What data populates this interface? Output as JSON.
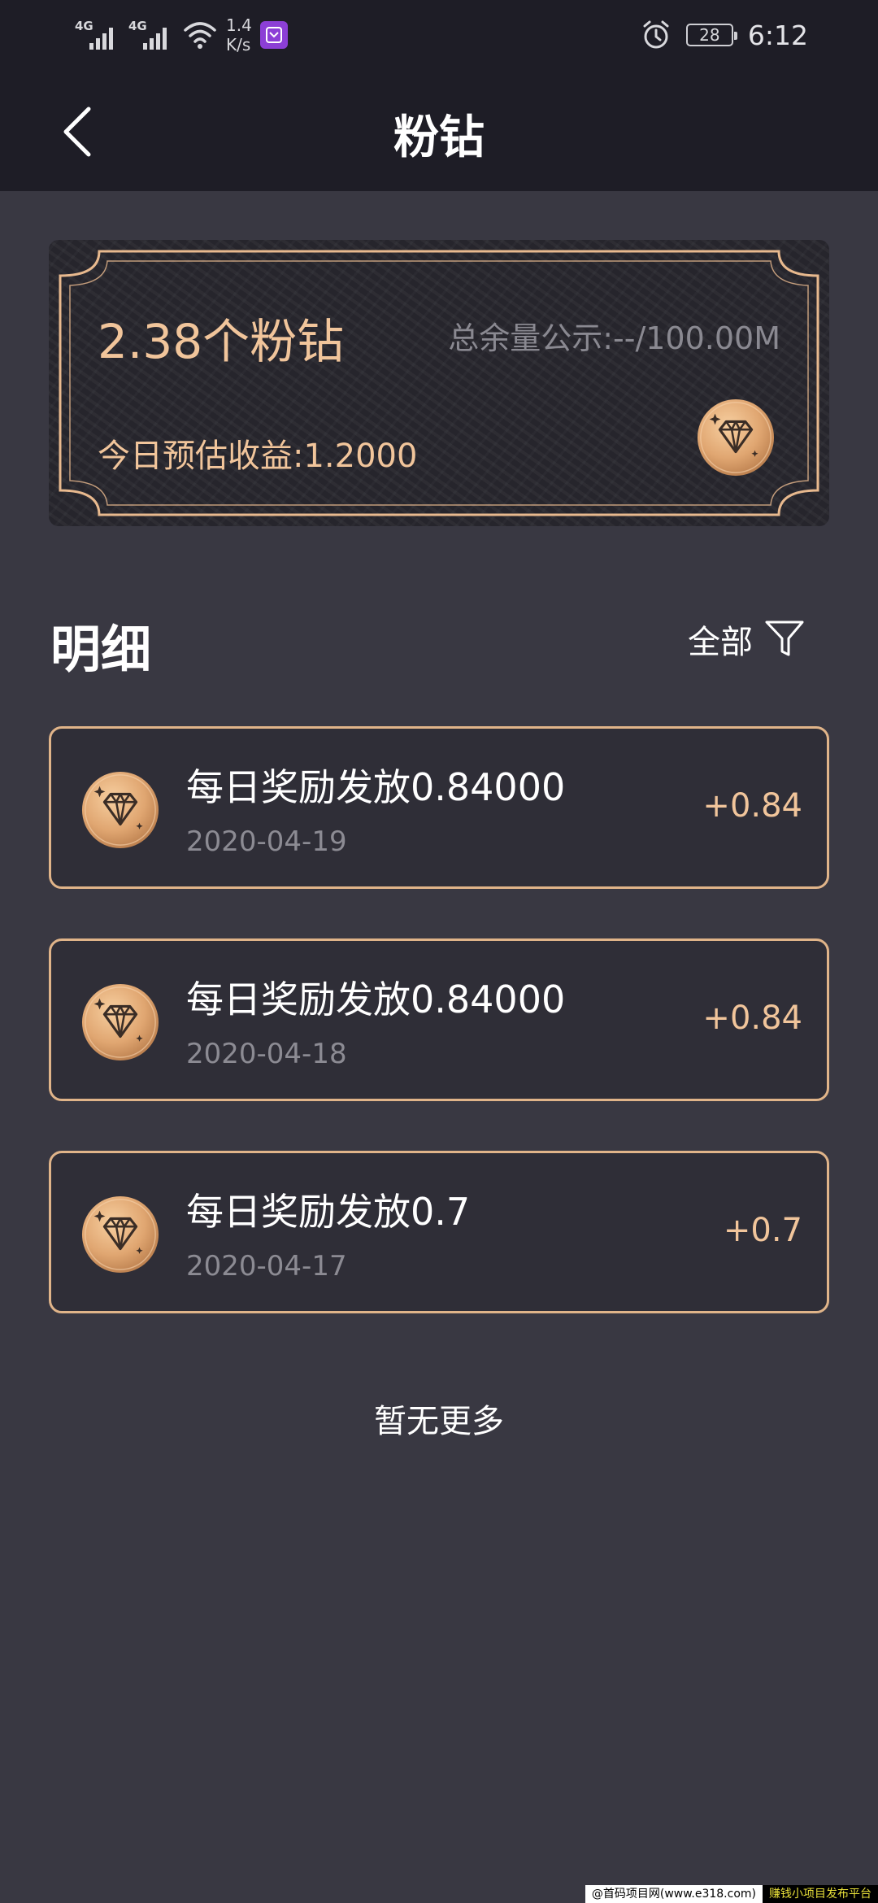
{
  "status_bar": {
    "signal1_tag": "4G",
    "signal2_tag": "4G",
    "net_speed_value": "1.4",
    "net_speed_unit": "K/s",
    "battery_level": "28",
    "time": "6:12"
  },
  "nav": {
    "title": "粉钻"
  },
  "balance_card": {
    "amount": "2.38个粉钻",
    "total_supply": "总余量公示:--/100.00M",
    "today_estimate": "今日预估收益:1.2000"
  },
  "details": {
    "title": "明细",
    "filter_label": "全部",
    "items": [
      {
        "title": "每日奖励发放0.84000",
        "date": "2020-04-19",
        "amount": "+0.84"
      },
      {
        "title": "每日奖励发放0.84000",
        "date": "2020-04-18",
        "amount": "+0.84"
      },
      {
        "title": "每日奖励发放0.7",
        "date": "2020-04-17",
        "amount": "+0.7"
      }
    ],
    "no_more": "暂无更多"
  },
  "watermark": {
    "left": "@首码项目网(www.e318.com)",
    "right": "赚钱小项目发布平台"
  },
  "colors": {
    "header_bg": "#1e1d26",
    "page_bg": "#393842",
    "accent_gold": "#f1c59b",
    "card_border": "#e0b489"
  },
  "icons": {
    "back": "chevron-left-icon",
    "filter": "filter-funnel-icon",
    "coin": "diamond-coin-icon"
  }
}
